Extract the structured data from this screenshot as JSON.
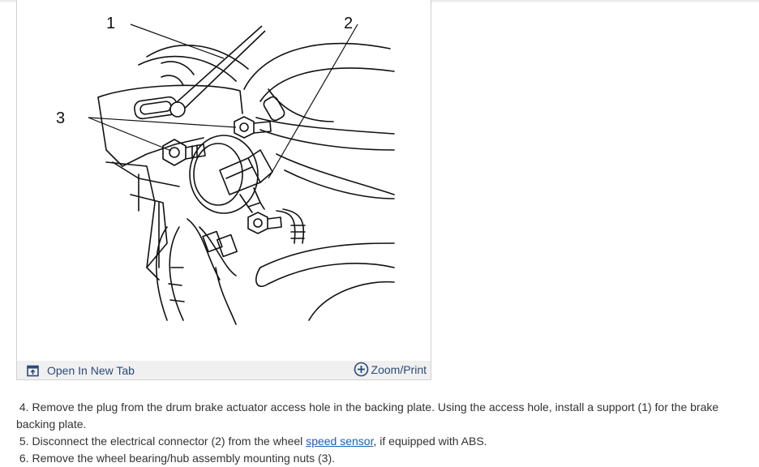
{
  "figure": {
    "callouts": {
      "c1": "1",
      "c2": "2",
      "c3": "3"
    },
    "toolbar": {
      "open_new_tab_label": "Open In New Tab",
      "zoom_print_label": "Zoom/Print"
    }
  },
  "steps": [
    {
      "number": "4.",
      "text": "Remove the plug from the drum brake actuator access hole in the backing plate. Using the access hole, install a support (1) for the brake backing plate."
    },
    {
      "number": "5.",
      "text_before": "Disconnect the electrical connector (2) from the wheel",
      "link": "speed sensor",
      "text_after": ", if equipped with ABS."
    },
    {
      "number": "6.",
      "text": "Remove the wheel bearing/hub assembly mounting nuts (3)."
    }
  ],
  "colors": {
    "link": "#1a5fb4",
    "toolbar_bg": "#f0f0f0",
    "toolbar_text": "#2a4a7a"
  }
}
